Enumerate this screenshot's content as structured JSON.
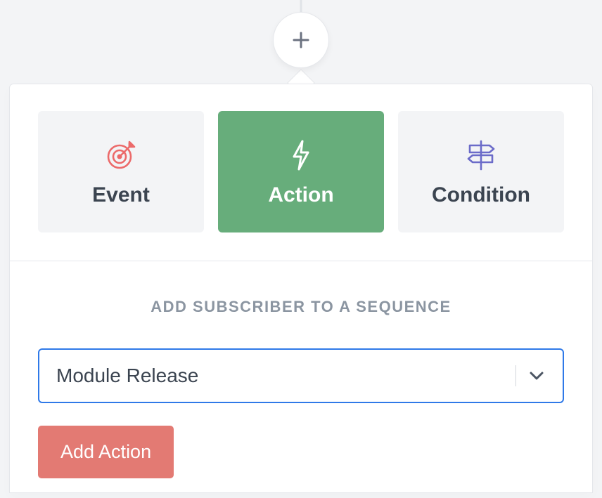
{
  "tabs": {
    "event": {
      "label": "Event"
    },
    "action": {
      "label": "Action"
    },
    "condition": {
      "label": "Condition"
    }
  },
  "panel": {
    "title": "ADD SUBSCRIBER TO A SEQUENCE"
  },
  "select": {
    "value": "Module Release"
  },
  "submit": {
    "label": "Add Action"
  },
  "colors": {
    "accent_green": "#67ad7b",
    "accent_blue": "#2f79e8",
    "accent_red": "#e37a73",
    "icon_red": "#ec6a6a",
    "icon_purple": "#6b6bc9",
    "muted": "#8b95a1"
  }
}
